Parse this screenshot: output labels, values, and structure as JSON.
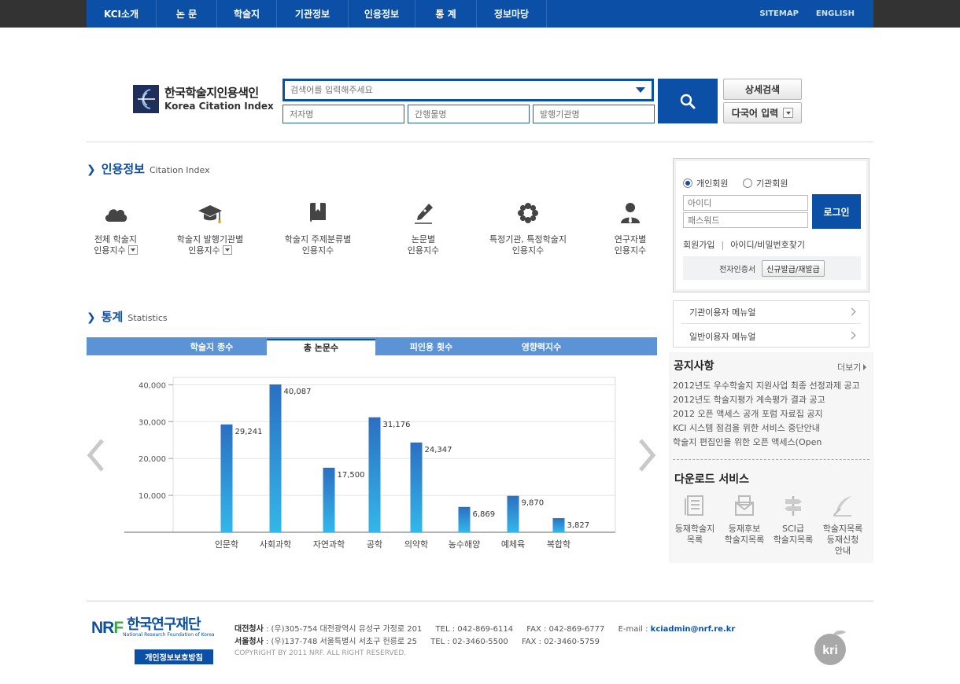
{
  "gnb": {
    "items": [
      "KCI소개",
      "논 문",
      "학술지",
      "기관정보",
      "인용정보",
      "통 계",
      "정보마당"
    ],
    "util": [
      "SITEMAP",
      "ENGLISH"
    ]
  },
  "logo": {
    "ko": "한국학술지인용색인",
    "en": "Korea Citation Index"
  },
  "search": {
    "main_placeholder": "검색어를 입력해주세요",
    "author_placeholder": "저자명",
    "journal_placeholder": "간행물명",
    "publisher_placeholder": "발행기관명",
    "advanced_label": "상세검색",
    "multilang_label": "다국어 입력"
  },
  "citation": {
    "title_ko": "인용정보",
    "title_en": "Citation Index",
    "items": [
      {
        "line1": "전체 학술지",
        "line2": "인용지수",
        "icon": "cloud-icon"
      },
      {
        "line1": "학술지 발행기관별",
        "line2": "인용지수",
        "icon": "graduation-cap-icon"
      },
      {
        "line1": "학술지 주제분류별",
        "line2": "인용지수",
        "icon": "book-icon"
      },
      {
        "line1": "논문별",
        "line2": "인용지수",
        "icon": "pen-icon"
      },
      {
        "line1": "특정기관, 특정학술지",
        "line2": "인용지수",
        "icon": "flower-icon"
      },
      {
        "line1": "연구자별",
        "line2": "인용지수",
        "icon": "person-icon"
      }
    ]
  },
  "stats": {
    "title_ko": "통계",
    "title_en": "Statistics",
    "tabs": [
      "학술지 종수",
      "총 논문수",
      "피인용 횟수",
      "영향력지수"
    ],
    "active_tab": 1
  },
  "chart_data": {
    "type": "bar",
    "categories": [
      "인문학",
      "사회과학",
      "자연과학",
      "공학",
      "의약학",
      "농수해양",
      "예체육",
      "복합학"
    ],
    "values": [
      29241,
      40087,
      17500,
      31176,
      24347,
      6869,
      9870,
      3827
    ],
    "value_labels": [
      "29,241",
      "40,087",
      "17,500",
      "31,176",
      "24,347",
      "6,869",
      "9,870",
      "3,827"
    ],
    "yticks": [
      "10,000",
      "20,000",
      "30,000",
      "40,000"
    ],
    "ytick_values": [
      10000,
      20000,
      30000,
      40000
    ],
    "ylim": [
      0,
      42000
    ],
    "grid": true,
    "colors": {
      "bar_top": "#2b6fc2",
      "bar_bottom": "#33b7ea"
    }
  },
  "login": {
    "personal": "개인회원",
    "institution": "기관회원",
    "id_placeholder": "아이디",
    "pw_placeholder": "패스워드",
    "login_button": "로그인",
    "join": "회원가입",
    "find": "아이디/비밀번호찾기",
    "cert_label": "전자인증서",
    "cert_button": "신규발급/재발급"
  },
  "manuals": [
    "기관이용자 메뉴얼",
    "일반이용자 메뉴얼"
  ],
  "notice": {
    "title": "공지사항",
    "more": "더보기",
    "items": [
      "2012년도 우수학술지 지원사업 최종 선정과제 공고",
      "2012년도 학술지평가 계속평가 결과 공고",
      "2012 오픈 액세스 공개 포럼 자료집 공지",
      "KCI 시스템 점검을 위한 서비스 중단안내",
      "학술지 편집인을 위한 오픈 액세스(Open"
    ]
  },
  "download": {
    "title": "다운로드 서비스",
    "items": [
      {
        "lines": [
          "등재학술지",
          "목록"
        ],
        "icon": "document-list-icon"
      },
      {
        "lines": [
          "등재후보",
          "학술지목록"
        ],
        "icon": "envelope-icon"
      },
      {
        "lines": [
          "SCI급",
          "학술지목록"
        ],
        "icon": "signpost-icon"
      },
      {
        "lines": [
          "학술지목록",
          "등재신청",
          "안내"
        ],
        "icon": "quill-icon"
      }
    ]
  },
  "footer": {
    "nrf_ko": "한국연구재단",
    "nrf_en": "National Research Foundation of Korea",
    "privacy": "개인정보보호방침",
    "daejeon_label": "대전청사",
    "daejeon_addr": ": (우)305-754 대전광역시 유성구 가정로 201",
    "daejeon_tel": "TEL : 042-869-6114",
    "daejeon_fax": "FAX : 042-869-6777",
    "email_label": "E-mail :",
    "email": "kciadmin@nrf.re.kr",
    "seoul_label": "서울청사",
    "seoul_addr": ": (우)137-748 서울특별시 서초구 헌릉로 25",
    "seoul_tel": "TEL : 02-3460-5500",
    "seoul_fax": "FAX : 02-3460-5759",
    "copyright": "COPYRIGHT BY 2011 NRF. ALL RIGHT RESERVED.",
    "kri": "kri"
  }
}
